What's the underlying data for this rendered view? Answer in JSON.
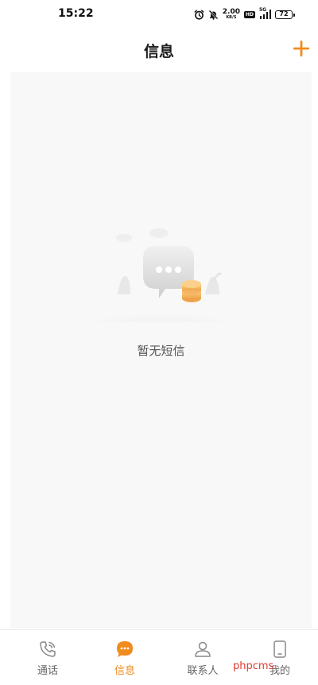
{
  "status_bar": {
    "time": "15:22",
    "net_speed_value": "2.00",
    "net_speed_unit": "KB/S",
    "hd_badge": "HD",
    "signal_label": "5G",
    "battery_level": "72",
    "icons": [
      "alarm-icon",
      "mute-icon",
      "signal-icon",
      "battery-icon"
    ]
  },
  "header": {
    "title": "信息",
    "add_icon": "plus-icon"
  },
  "empty_state": {
    "message": "暂无短信",
    "illustration": "chat-bubble-with-coins"
  },
  "tab_bar": {
    "items": [
      {
        "label": "通话",
        "icon": "phone-icon",
        "active": false
      },
      {
        "label": "信息",
        "icon": "message-bubble-icon",
        "active": true
      },
      {
        "label": "联系人",
        "icon": "person-icon",
        "active": false
      },
      {
        "label": "我的",
        "icon": "device-icon",
        "active": false
      }
    ]
  },
  "watermark": "phpcms",
  "colors": {
    "accent": "#f08c1d",
    "background": "#ffffff",
    "content_background": "#f8f8f8",
    "watermark": "#e03a2f"
  }
}
